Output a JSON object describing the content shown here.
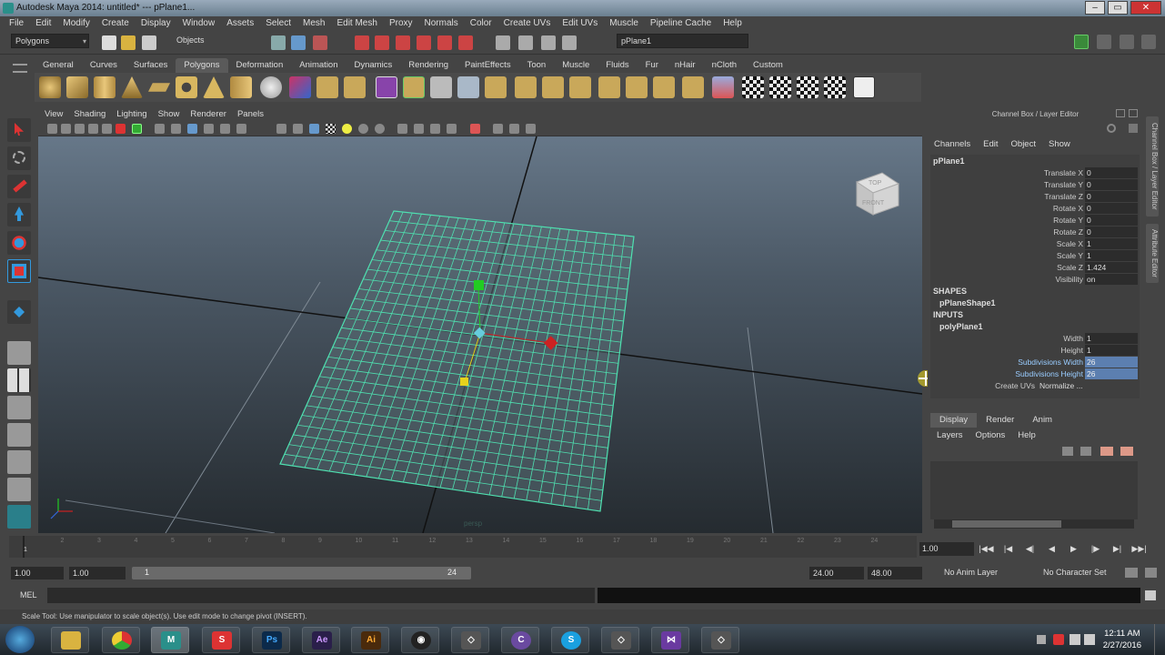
{
  "window": {
    "title": "Autodesk Maya 2014: untitled*  ---  pPlane1..."
  },
  "menubar": [
    "File",
    "Edit",
    "Modify",
    "Create",
    "Display",
    "Window",
    "Assets",
    "Select",
    "Mesh",
    "Edit Mesh",
    "Proxy",
    "Normals",
    "Color",
    "Create UVs",
    "Edit UVs",
    "Muscle",
    "Pipeline Cache",
    "Help"
  ],
  "statusline": {
    "menuset": "Polygons",
    "selection_mode": "Objects",
    "name_field": "pPlane1"
  },
  "shelf_tabs": [
    "General",
    "Curves",
    "Surfaces",
    "Polygons",
    "Deformation",
    "Animation",
    "Dynamics",
    "Rendering",
    "PaintEffects",
    "Toon",
    "Muscle",
    "Fluids",
    "Fur",
    "nHair",
    "nCloth",
    "Custom"
  ],
  "shelf_active_tab": "Polygons",
  "viewport": {
    "menu": [
      "View",
      "Shading",
      "Lighting",
      "Show",
      "Renderer",
      "Panels"
    ],
    "viewcube": {
      "top": "TOP",
      "front": "FRONT"
    },
    "camera_label": "persp"
  },
  "channel_box": {
    "title": "Channel Box / Layer Editor",
    "menu": [
      "Channels",
      "Edit",
      "Object",
      "Show"
    ],
    "object_name": "pPlane1",
    "attributes": [
      {
        "label": "Translate X",
        "value": "0"
      },
      {
        "label": "Translate Y",
        "value": "0"
      },
      {
        "label": "Translate Z",
        "value": "0"
      },
      {
        "label": "Rotate X",
        "value": "0"
      },
      {
        "label": "Rotate Y",
        "value": "0"
      },
      {
        "label": "Rotate Z",
        "value": "0"
      },
      {
        "label": "Scale X",
        "value": "1"
      },
      {
        "label": "Scale Y",
        "value": "1"
      },
      {
        "label": "Scale Z",
        "value": "1.424"
      },
      {
        "label": "Visibility",
        "value": "on"
      }
    ],
    "shapes_header": "SHAPES",
    "shape_name": "pPlaneShape1",
    "inputs_header": "INPUTS",
    "input_name": "polyPlane1",
    "input_attributes": [
      {
        "label": "Width",
        "value": "1",
        "selected": false
      },
      {
        "label": "Height",
        "value": "1",
        "selected": false
      },
      {
        "label": "Subdivisions Width",
        "value": "26",
        "selected": true
      },
      {
        "label": "Subdivisions Height",
        "value": "26",
        "selected": true
      },
      {
        "label": "Create UVs",
        "value": "Normalize ...",
        "selected": false
      }
    ]
  },
  "side_tabs": [
    "Channel Box / Layer Editor",
    "Attribute Editor"
  ],
  "layer_editor": {
    "tabs": [
      "Display",
      "Render",
      "Anim"
    ],
    "active_tab": "Display",
    "menu": [
      "Layers",
      "Options",
      "Help"
    ]
  },
  "timeline": {
    "ticks": [
      "1",
      "2",
      "3",
      "4",
      "5",
      "6",
      "7",
      "8",
      "9",
      "10",
      "11",
      "12",
      "13",
      "14",
      "15",
      "16",
      "17",
      "18",
      "19",
      "20",
      "21",
      "22",
      "23",
      "24"
    ],
    "current_frame": "1.00"
  },
  "range": {
    "start": "1.00",
    "playback_start": "1.00",
    "slider_start": "1",
    "slider_end": "24",
    "playback_end": "24.00",
    "end": "48.00",
    "anim_layer": "No Anim Layer",
    "character_set": "No Character Set"
  },
  "command_line": {
    "label": "MEL"
  },
  "help_line": "Scale Tool: Use manipulator to scale object(s). Use edit mode to change pivot (INSERT).",
  "taskbar": {
    "apps": [
      "explorer",
      "chrome",
      "maya",
      "s-app",
      "Ps",
      "Ae",
      "Ai",
      "obs",
      "sketchup",
      "c-app",
      "skype",
      "sketchup2",
      "vs",
      "sketchup3"
    ],
    "time": "12:11 AM",
    "date": "2/27/2016"
  },
  "colors": {
    "accent_selected": "#5c7fb0",
    "grid": "#4fe0b0",
    "x_axis": "#cc2222",
    "y_axis": "#22cc22",
    "z_axis": "#e6d21c"
  }
}
